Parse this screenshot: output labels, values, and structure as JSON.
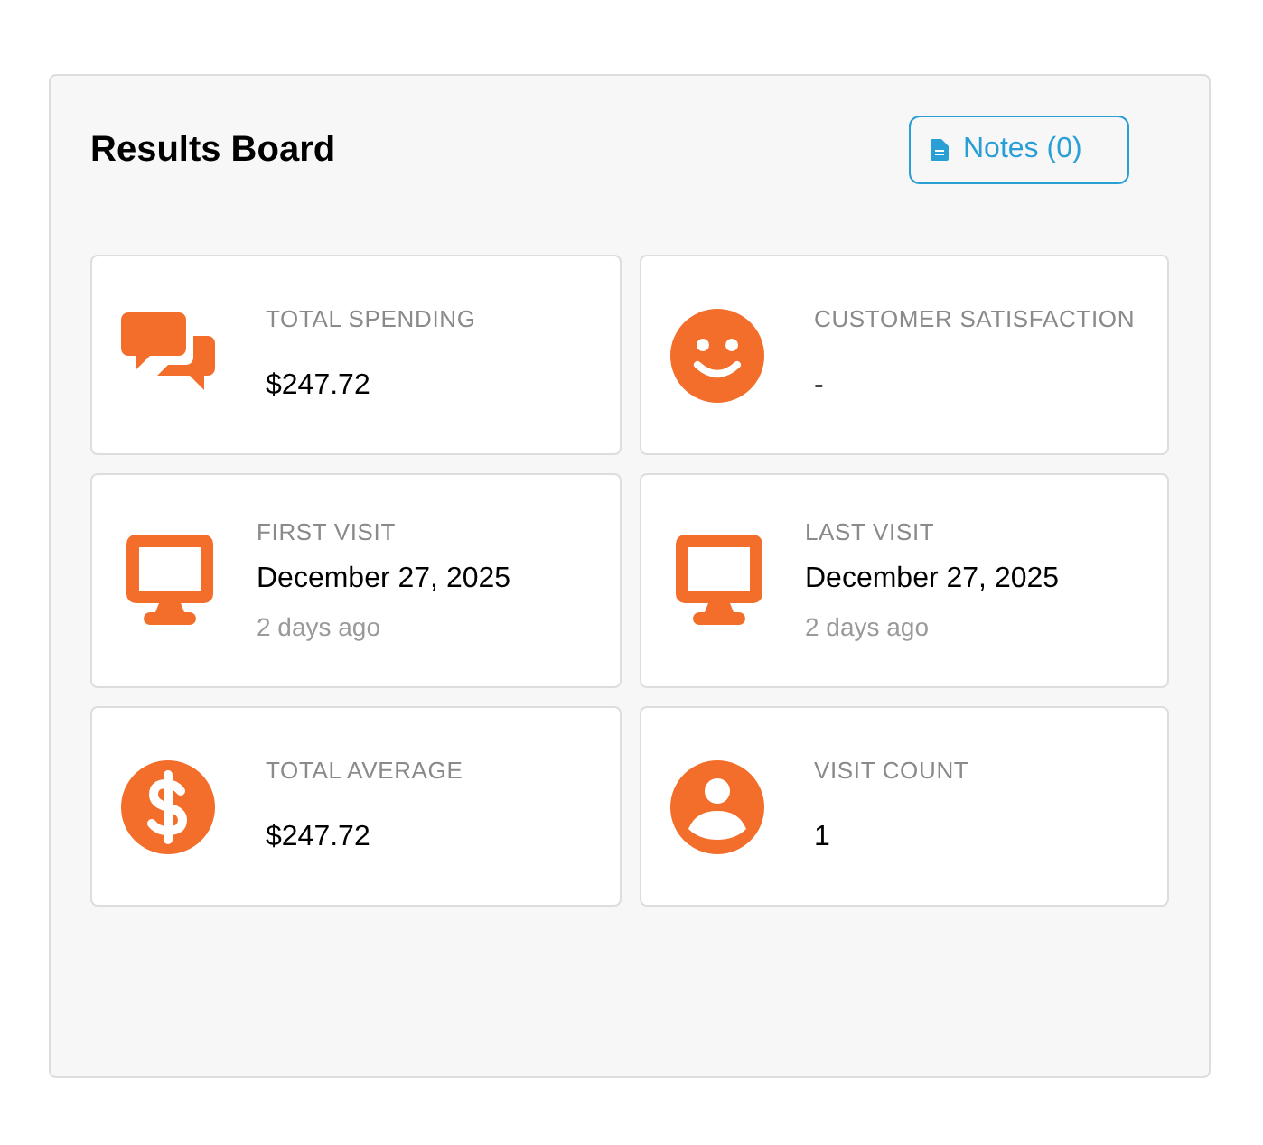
{
  "title": "Results Board",
  "notes_button": {
    "label": "Notes (0)"
  },
  "cards": [
    {
      "kind": "spending",
      "label": "TOTAL SPENDING",
      "value": "$247.72"
    },
    {
      "kind": "satisfaction",
      "label": "CUSTOMER SATISFACTION",
      "value": "-"
    },
    {
      "kind": "visit",
      "label": "FIRST VISIT",
      "value": "December 27, 2025",
      "sub": "2 days ago"
    },
    {
      "kind": "visit",
      "label": "LAST VISIT",
      "value": "December 27, 2025",
      "sub": "2 days ago"
    },
    {
      "kind": "average",
      "label": "TOTAL AVERAGE",
      "value": "$247.72"
    },
    {
      "kind": "count",
      "label": "VISIT COUNT",
      "value": "1"
    }
  ]
}
